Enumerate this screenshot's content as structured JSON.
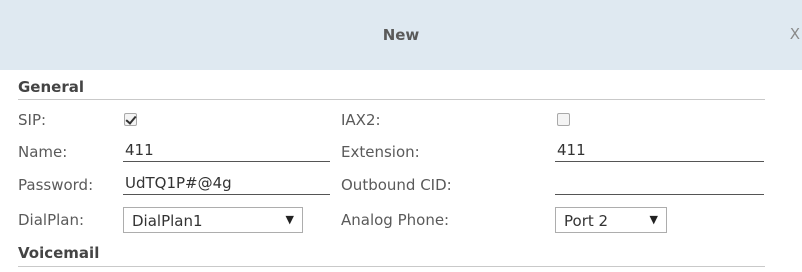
{
  "dialog": {
    "title": "New",
    "close_label": "X"
  },
  "sections": {
    "general": "General",
    "voicemail": "Voicemail"
  },
  "form": {
    "sip": {
      "label": "SIP:",
      "checked": true
    },
    "iax2": {
      "label": "IAX2:",
      "checked": false
    },
    "name": {
      "label": "Name:",
      "value": "411"
    },
    "extension": {
      "label": "Extension:",
      "value": "411"
    },
    "password": {
      "label": "Password:",
      "value": "UdTQ1P#@4g"
    },
    "outbound_cid": {
      "label": "Outbound CID:",
      "value": ""
    },
    "dialplan": {
      "label": "DialPlan:",
      "selected": "DialPlan1"
    },
    "analog_phone": {
      "label": "Analog Phone:",
      "selected": "Port 2"
    }
  },
  "icons": {
    "dropdown": "▼"
  },
  "colors": {
    "titlebar_bg": "#dfe9f1",
    "text": "#5a5a5a"
  }
}
